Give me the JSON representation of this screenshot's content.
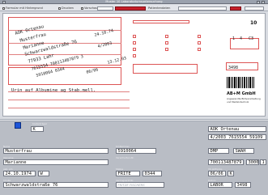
{
  "window": {
    "title": "Muster 10 Laboratoriumsuntersuchung"
  },
  "toolbar": {
    "option1": "Formular mit Hintergrund",
    "option2": "Drucken",
    "option3": "Vorschau",
    "option4": "Patientendaten"
  },
  "form": {
    "number": "10",
    "printed": {
      "line1": "AOK Ortenau",
      "line2": "Musterfrau",
      "line3": "Marianne",
      "line4": "Schwarzwaldstraße 76",
      "line5": "77933 Lahr",
      "line6": "7615554  700113487879  3",
      "line7": "5910064  0344",
      "line8": "24.10.74",
      "line9": "4/2003",
      "line10": "06/06",
      "line11": "13.12.03",
      "line12": "K",
      "line13": "3000",
      "line14": "1",
      "line15": "3498",
      "note": "Urin auf Albumine ag Stab.mell."
    },
    "right_marks": {
      "x1": "1",
      "x2": "4",
      "x3": "C3",
      "x4": "3498"
    },
    "lab_name": "AB+M GmbH",
    "lab_line2": "Angewandte Bildverarbeitung",
    "lab_line3": "und Medizintechnik"
  },
  "lower": {
    "labels": {
      "kostentraeger": "Kostenträger",
      "name": "Name",
      "vorname": "Vorname",
      "geb": "geb. am",
      "strasse": "Straße",
      "kv": "KV-Nummer",
      "status": "Status",
      "versnr": "Versicherten-Nr.",
      "vk": "VK gültig bis",
      "datum": "Datum",
      "arzt": "Vertragsarzt-Nr."
    },
    "fields": {
      "k": "K",
      "kasse": "AOK Ortenau",
      "kkinfo": "4/2003  7615554  59109",
      "name": "Musterfrau",
      "bnr": "5910064",
      "dmp": "DMP",
      "dmp_val": "SWAH",
      "vorname": "Marianne",
      "versnr": "700113487879",
      "status": "3000",
      "status2": "1",
      "geb": "24.10.1974",
      "geschlecht": "W",
      "frei": "FRITE",
      "frei_nr": "0344",
      "vk": "06/06",
      "vk_flag": "K",
      "strasse": "Schwarzwaldstraße 76",
      "placeholder_fischer": "FRITZE FISCHERS",
      "labor": "LABOR",
      "labor_nr": "3498"
    }
  },
  "colors": {
    "accent_blue": "#1d55d8",
    "toolbar_red": "#c7202a"
  }
}
